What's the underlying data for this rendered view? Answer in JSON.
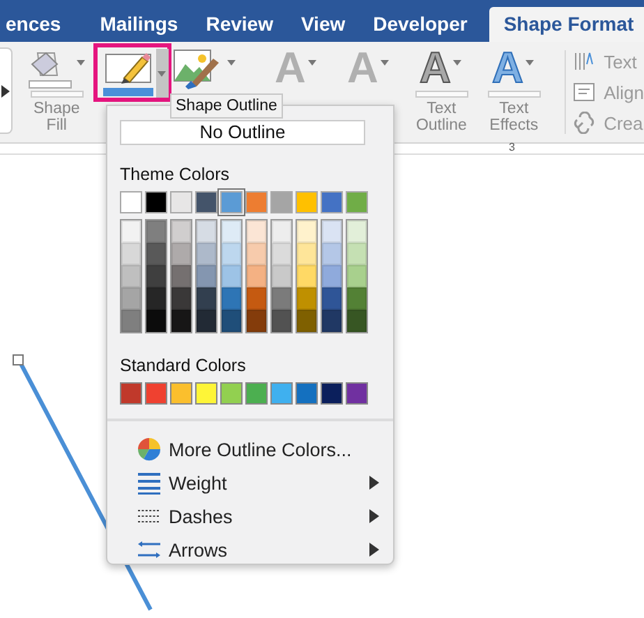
{
  "tabs": [
    {
      "label": "ences",
      "selected": false
    },
    {
      "label": "Mailings",
      "selected": false
    },
    {
      "label": "Review",
      "selected": false
    },
    {
      "label": "View",
      "selected": false
    },
    {
      "label": "Developer",
      "selected": false
    },
    {
      "label": "Shape Format",
      "selected": true
    }
  ],
  "ribbon": {
    "buttons": [
      {
        "kind": "shape-fill",
        "label": "Shape Fill",
        "highlighted": false
      },
      {
        "kind": "shape-outline",
        "highlighted": true
      },
      {
        "kind": "picture-brush",
        "highlighted": false
      },
      {
        "kind": "text-fill",
        "glyph": "A",
        "highlighted": false
      },
      {
        "kind": "text-plain",
        "glyph": "A",
        "highlighted": false
      },
      {
        "kind": "text-outline",
        "glyph": "A",
        "label": "Text Outline",
        "highlighted": false
      },
      {
        "kind": "text-effects",
        "glyph": "A",
        "label": "Text Effects",
        "highlighted": false
      }
    ],
    "side_items": [
      {
        "kind": "text-direction",
        "label": "Text"
      },
      {
        "kind": "align",
        "label": "Align"
      },
      {
        "kind": "link",
        "label": "Crea"
      }
    ]
  },
  "tooltip": "Shape Outline",
  "ruler": {
    "mark": "3"
  },
  "menu": {
    "no_outline": "No Outline",
    "theme_title": "Theme Colors",
    "theme_colors": [
      {
        "color": "#ffffff",
        "selected": false,
        "shades": [
          {
            "color": "#f2f2f2"
          },
          {
            "color": "#d8d8d8"
          },
          {
            "color": "#bfbfbf"
          },
          {
            "color": "#a5a5a5"
          },
          {
            "color": "#7f7f7f"
          }
        ]
      },
      {
        "color": "#000000",
        "selected": false,
        "shades": [
          {
            "color": "#7f7f7f"
          },
          {
            "color": "#595959"
          },
          {
            "color": "#3f3f3f"
          },
          {
            "color": "#262626"
          },
          {
            "color": "#0c0c0c"
          }
        ]
      },
      {
        "color": "#e7e6e6",
        "selected": false,
        "shades": [
          {
            "color": "#d0cece"
          },
          {
            "color": "#aeaaaa"
          },
          {
            "color": "#757070"
          },
          {
            "color": "#3a3838"
          },
          {
            "color": "#171616"
          }
        ]
      },
      {
        "color": "#44546a",
        "selected": false,
        "shades": [
          {
            "color": "#d6dce4"
          },
          {
            "color": "#adb9ca"
          },
          {
            "color": "#8496b0"
          },
          {
            "color": "#323f4f"
          },
          {
            "color": "#222a35"
          }
        ]
      },
      {
        "color": "#5b9bd5",
        "selected": true,
        "shades": [
          {
            "color": "#deebf6"
          },
          {
            "color": "#bdd7ee"
          },
          {
            "color": "#9dc3e6"
          },
          {
            "color": "#2e75b5"
          },
          {
            "color": "#1f4e79"
          }
        ]
      },
      {
        "color": "#ed7d31",
        "selected": false,
        "shades": [
          {
            "color": "#fbe5d5"
          },
          {
            "color": "#f7cbac"
          },
          {
            "color": "#f4b183"
          },
          {
            "color": "#c55a11"
          },
          {
            "color": "#843c0b"
          }
        ]
      },
      {
        "color": "#a5a5a5",
        "selected": false,
        "shades": [
          {
            "color": "#ededed"
          },
          {
            "color": "#dbdbdb"
          },
          {
            "color": "#c9c9c9"
          },
          {
            "color": "#7b7b7b"
          },
          {
            "color": "#525252"
          }
        ]
      },
      {
        "color": "#ffc000",
        "selected": false,
        "shades": [
          {
            "color": "#fff2cc"
          },
          {
            "color": "#fee599"
          },
          {
            "color": "#ffd965"
          },
          {
            "color": "#bf9000"
          },
          {
            "color": "#7f6000"
          }
        ]
      },
      {
        "color": "#4472c4",
        "selected": false,
        "shades": [
          {
            "color": "#dae3f3"
          },
          {
            "color": "#b4c7e7"
          },
          {
            "color": "#8faadc"
          },
          {
            "color": "#2f5597"
          },
          {
            "color": "#203864"
          }
        ]
      },
      {
        "color": "#70ad47",
        "selected": false,
        "shades": [
          {
            "color": "#e2efd9"
          },
          {
            "color": "#c5e0b3"
          },
          {
            "color": "#a8d08d"
          },
          {
            "color": "#538135"
          },
          {
            "color": "#375623"
          }
        ]
      }
    ],
    "standard_title": "Standard Colors",
    "standard_colors": [
      {
        "color": "#c0392b"
      },
      {
        "color": "#ef4130"
      },
      {
        "color": "#fbbf2d"
      },
      {
        "color": "#fef537"
      },
      {
        "color": "#92d050"
      },
      {
        "color": "#4caf50"
      },
      {
        "color": "#3fb0ef"
      },
      {
        "color": "#1470bf"
      },
      {
        "color": "#0b1f5c"
      },
      {
        "color": "#7030a0"
      }
    ],
    "items": [
      {
        "kind": "color-wheel",
        "label": "More Outline Colors...",
        "has_submenu": false
      },
      {
        "kind": "weight",
        "label": "Weight",
        "has_submenu": true
      },
      {
        "kind": "dashes",
        "label": "Dashes",
        "has_submenu": true
      },
      {
        "kind": "arrows",
        "label": "Arrows",
        "has_submenu": true
      }
    ]
  }
}
